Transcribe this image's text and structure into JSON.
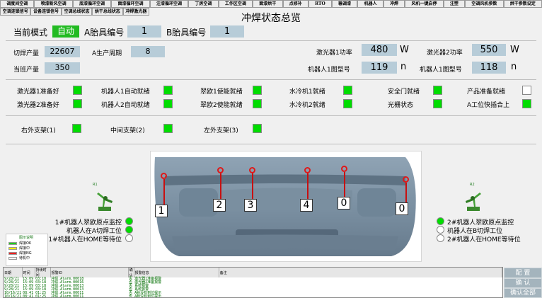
{
  "nav": {
    "row1": [
      "调度间空调",
      "喷漆新风空调",
      "底漆循环空调",
      "面漆循环空调",
      "注漆循环空调",
      "丁房空调",
      "工作区空调",
      "面漆烘干",
      "点修补",
      "RTO",
      "输调漆",
      "机器人",
      "冲焊",
      "风机一键启停",
      "注塑",
      "空调风机参数",
      "烘干参数设定"
    ],
    "row2": [
      "空调连锁信号",
      "设备连锁信号",
      "空调总线状态",
      "烘干总线状态",
      "冲焊激光器"
    ]
  },
  "page_title": "冲焊状态总览",
  "status": {
    "mode_label": "当前模式",
    "mode_value": "自动",
    "a_fixture_label": "A胎具编号",
    "a_fixture_value": "1",
    "b_fixture_label": "B胎具编号",
    "b_fixture_value": "1"
  },
  "production": {
    "cut_label": "切焊产量",
    "cut_value": "22607",
    "cycle_label": "A生产周期",
    "cycle_value": "8",
    "shift_label": "当班产量",
    "shift_value": "350"
  },
  "laser": {
    "l1_power_label": "激光器1功率",
    "l1_power_value": "480",
    "l1_unit": "W",
    "l2_power_label": "激光器2功率",
    "l2_power_value": "550",
    "l2_unit": "W",
    "r1_map_label": "机器人1图型号",
    "r1_map_value": "119",
    "r1_unit": "n",
    "r2_map_label": "机器人1图型号",
    "r2_map_value": "118",
    "r2_unit": "n"
  },
  "indicators_row1": [
    {
      "label": "激光器1准备好",
      "on": true
    },
    {
      "label": "机器人1自动就绪",
      "on": true
    },
    {
      "label": "翠欧1使能就绪",
      "on": true
    },
    {
      "label": "水冷机1就绪",
      "on": true
    },
    {
      "label": "安全门就绪",
      "on": true
    },
    {
      "label": "产品准备就绪",
      "on": false
    }
  ],
  "indicators_row2": [
    {
      "label": "激光器2准备好",
      "on": true
    },
    {
      "label": "机器人2自动就绪",
      "on": true
    },
    {
      "label": "翠欧2使能就绪",
      "on": true
    },
    {
      "label": "水冷机2就绪",
      "on": true
    },
    {
      "label": "光栅状态",
      "on": true
    },
    {
      "label": "A工位快插合上",
      "on": true
    }
  ],
  "supports": [
    {
      "label": "右外支架(1)",
      "on": true
    },
    {
      "label": "中间支架(2)",
      "on": true
    },
    {
      "label": "左外支架(3)",
      "on": true
    }
  ],
  "photo": {
    "numbers": [
      "1",
      "2",
      "3",
      "4",
      "0",
      "0"
    ]
  },
  "robot1": {
    "tag": "R1",
    "items": [
      {
        "label": "1#机器人翠欧原点监控",
        "on": true
      },
      {
        "label": "机器人在A切焊工位",
        "on": true
      },
      {
        "label": "1#机器人在HOME等待位",
        "on": false
      }
    ]
  },
  "robot2": {
    "tag": "R2",
    "items": [
      {
        "label": "2#机器人翠欧原点监控",
        "on": true
      },
      {
        "label": "机器人在B切焊工位",
        "on": false
      },
      {
        "label": "2#机器人在HOME等待位",
        "on": false
      }
    ]
  },
  "legend": {
    "title": "图示说明",
    "items": [
      {
        "label": "焊接OK",
        "color": "#22cc22"
      },
      {
        "label": "焊接中",
        "color": "#ffee00"
      },
      {
        "label": "焊接NG",
        "color": "#ee2222"
      },
      {
        "label": "待机中",
        "color": "#ffffff"
      }
    ]
  },
  "alarm": {
    "headers": [
      "日期",
      "时间",
      "持续时间",
      "报警ID",
      "确认",
      "报警信息",
      "备注"
    ],
    "rows": [
      [
        "9/28/21",
        "15:09",
        "03:18",
        "冲焊.Alarm.00018",
        "否",
        "激光器1准备报警"
      ],
      [
        "9/28/21",
        "15:09",
        "03:18",
        "冲焊.Alarm.00016",
        "否",
        "激光器2准备报警"
      ],
      [
        "9/28/21",
        "15:09",
        "03:18",
        "冲焊.Alarm.00013",
        "否",
        "系统报警"
      ],
      [
        "9/28/21",
        "15:09",
        "03:18",
        "冲焊.Alarm.00013",
        "否",
        "系统报警"
      ],
      [
        "10/16/21",
        "08:41",
        "01:25",
        "冲焊.Alarm.00011",
        "否",
        "A胎没有到位提示"
      ],
      [
        "10/16/21",
        "08:41",
        "01:25",
        "冲焊.Alarm.00011",
        "否",
        "A胎没有到位提示"
      ]
    ]
  },
  "buttons": {
    "config": "配 置",
    "confirm": "确 认",
    "confirm_all": "确认全部"
  },
  "colors": {
    "indicator_on": "#00dd00",
    "value_box": "#b7ccd8",
    "mode_on": "#22bb22",
    "marker_red": "#e01818"
  }
}
